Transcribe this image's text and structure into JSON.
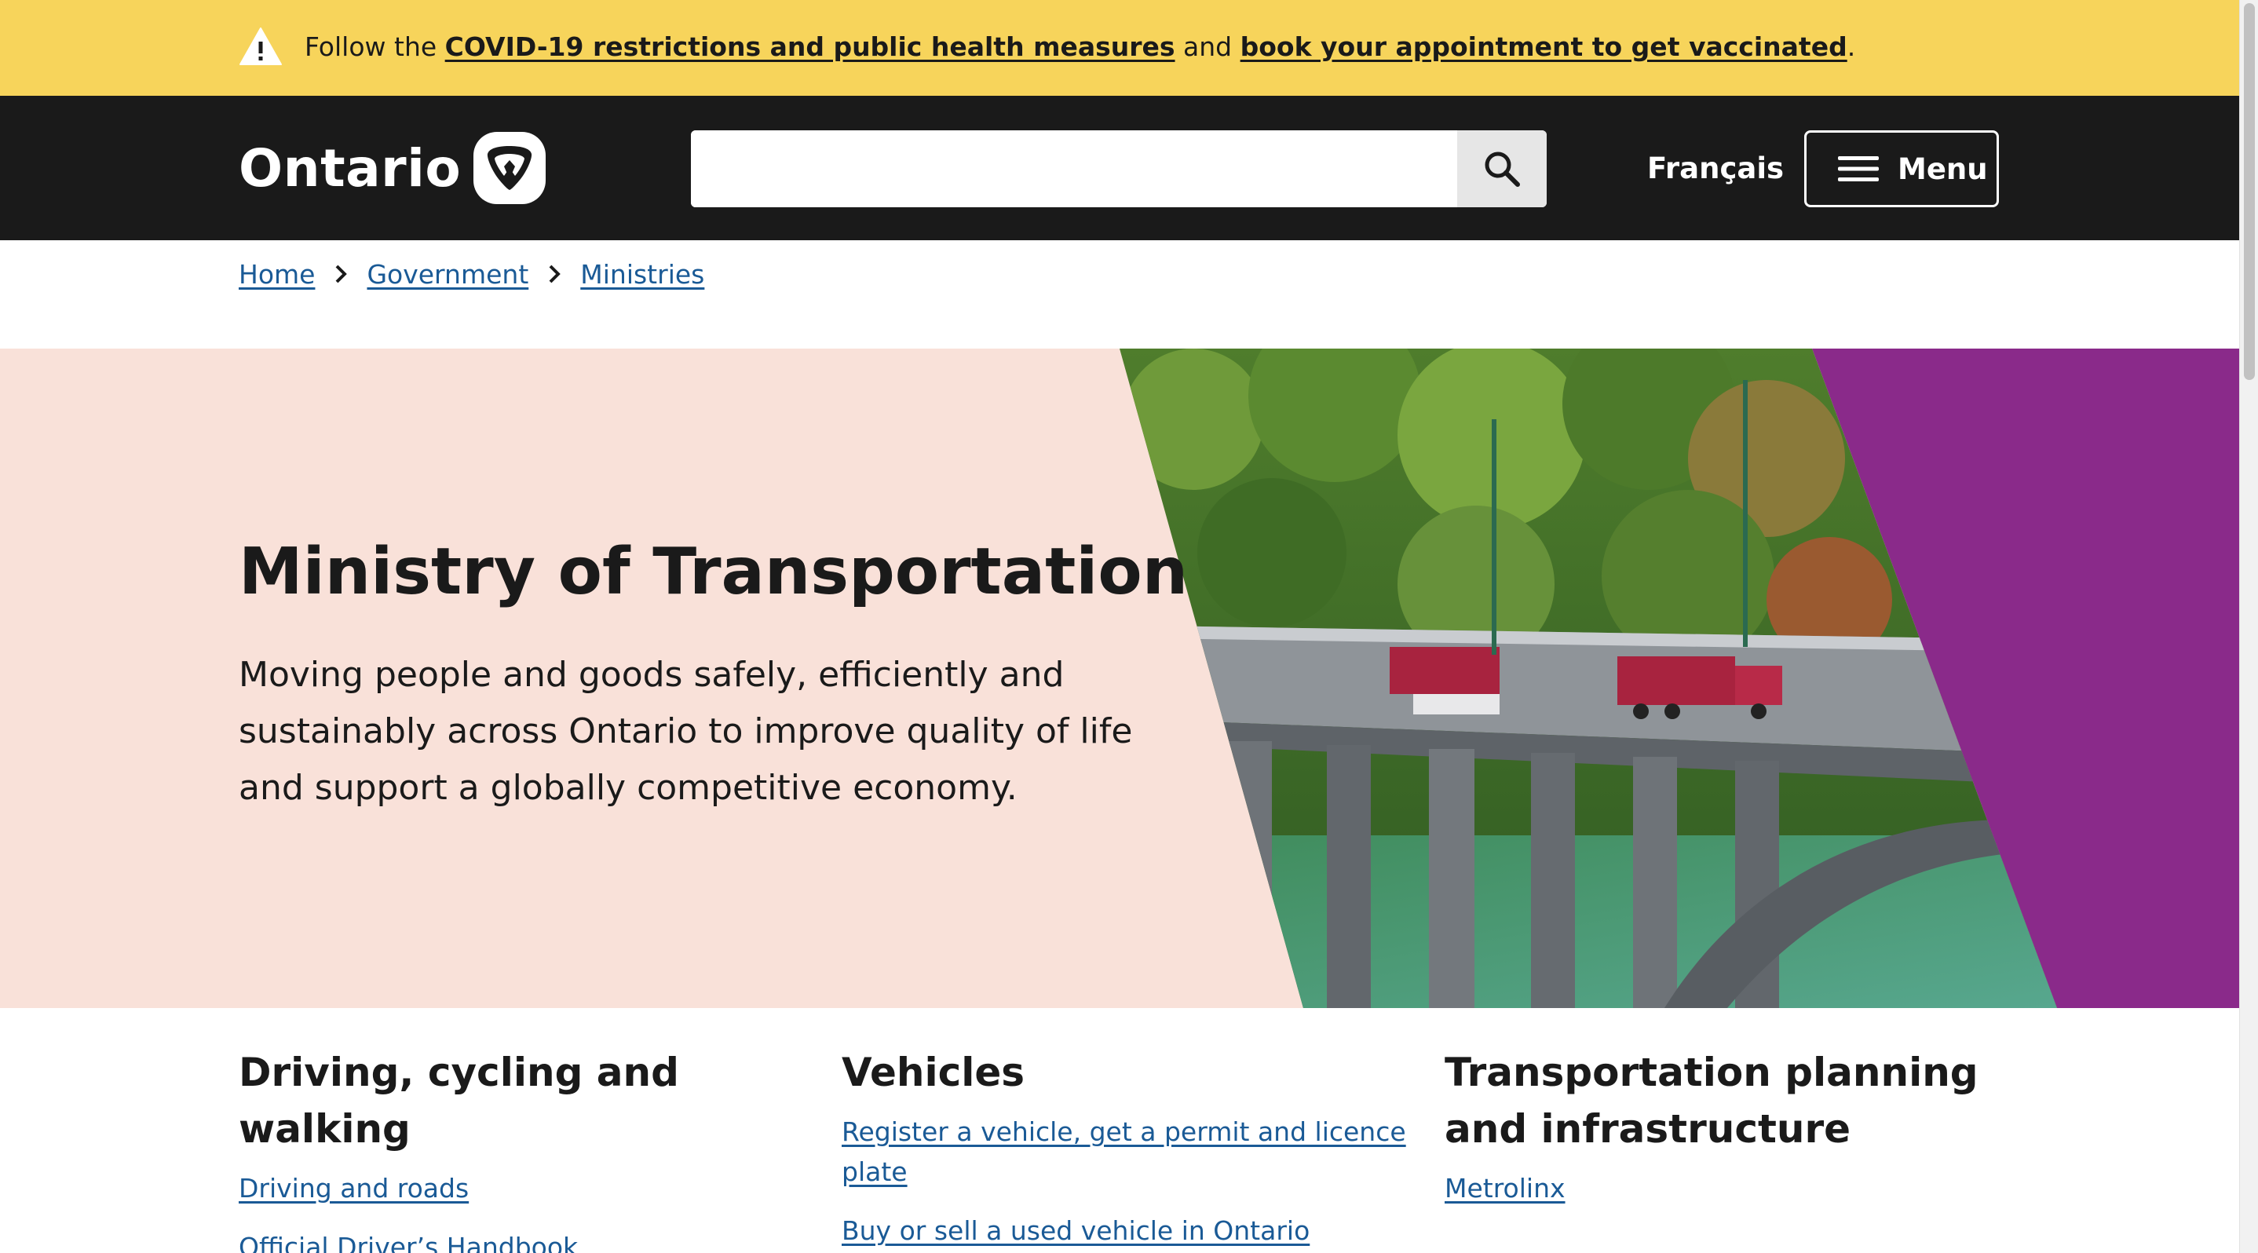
{
  "alert": {
    "prefix": "Follow the ",
    "link1": "COVID-19 restrictions and public health measures",
    "middle": " and ",
    "link2": "book your appointment to get vaccinated",
    "suffix": ".",
    "icon": "warning-icon"
  },
  "header": {
    "logo_text": "Ontario",
    "logo_icon": "trillium-icon",
    "search": {
      "value": "",
      "placeholder": "",
      "icon": "search-icon"
    },
    "language_link": "Français",
    "menu_label": "Menu",
    "menu_icon": "hamburger-icon",
    "background": "#1a1a1a"
  },
  "breadcrumb": {
    "items": [
      "Home",
      "Government",
      "Ministries"
    ],
    "separator_icon": "chevron-right-icon"
  },
  "hero": {
    "title": "Ministry of Transportation",
    "description": "Moving people and goods safely, efficiently and sustainably across Ontario to improve quality of life and support a globally competitive economy.",
    "image": "bridge-trucks-photo",
    "background": "#f9e1d9",
    "accent": "#8a2a8a"
  },
  "columns": [
    {
      "title": "Driving, cycling and walking",
      "links": [
        "Driving and roads",
        "Official Driver’s Handbook"
      ]
    },
    {
      "title": "Vehicles",
      "links": [
        "Register a vehicle, get a permit and licence plate",
        "Buy or sell a used vehicle in Ontario"
      ]
    },
    {
      "title": "Transportation planning and infrastructure",
      "links": [
        "Metrolinx"
      ]
    }
  ],
  "colors": {
    "alert": "#f7d45b",
    "link": "#1a5a96",
    "text": "#1a1a1a"
  }
}
